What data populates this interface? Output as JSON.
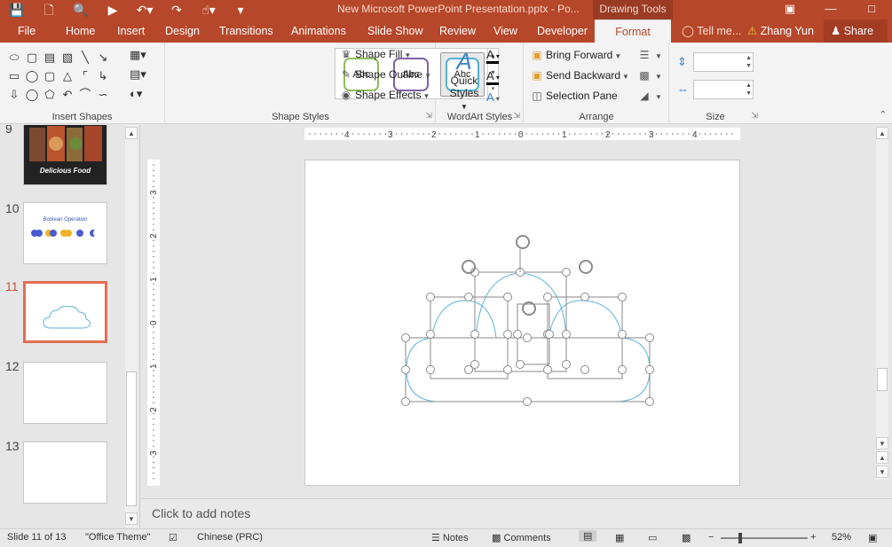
{
  "titlebar": {
    "doc_title": "New Microsoft PowerPoint Presentation.pptx - Po...",
    "context_tab": "Drawing Tools"
  },
  "tabs": [
    "File",
    "Home",
    "Insert",
    "Design",
    "Transitions",
    "Animations",
    "Slide Show",
    "Review",
    "View",
    "Developer",
    "Format"
  ],
  "active_tab": "Format",
  "tell_me": "Tell me...",
  "user_name": "Zhang Yun",
  "share_label": "Share",
  "ribbon": {
    "insert_shapes_label": "Insert Shapes",
    "shape_styles_label": "Shape Styles",
    "wordart_label": "WordArt Styles",
    "arrange_label": "Arrange",
    "size_label": "Size",
    "style_preview_text": "Abc",
    "shape_fill": "Shape Fill",
    "shape_outline": "Shape Outline",
    "shape_effects": "Shape Effects",
    "quick_styles_line1": "Quick",
    "quick_styles_line2": "Styles",
    "bring_forward": "Bring Forward",
    "send_backward": "Send Backward",
    "selection_pane": "Selection Pane"
  },
  "thumbnails": {
    "slide9_caption": "Delicious Food",
    "slide10_title": "Boolean Operation"
  },
  "slide_numbers": [
    "9",
    "10",
    "11",
    "12",
    "13"
  ],
  "ruler": {
    "horizontal_labels": [
      "4",
      "3",
      "2",
      "1",
      "0",
      "1",
      "2",
      "3",
      "4"
    ],
    "vertical_labels": [
      "3",
      "2",
      "1",
      "0",
      "1",
      "2",
      "3"
    ]
  },
  "notes_placeholder": "Click to add notes",
  "status": {
    "slide_info": "Slide 11 of 13",
    "theme": "\"Office Theme\"",
    "language": "Chinese (PRC)",
    "notes": "Notes",
    "comments": "Comments",
    "zoom": "52%"
  },
  "colors": {
    "brand": "#b7472a",
    "cloud_stroke": "#5fb3d9",
    "style1": "#8fbc5a",
    "style2": "#7e64a8",
    "style3": "#53b0d6"
  }
}
